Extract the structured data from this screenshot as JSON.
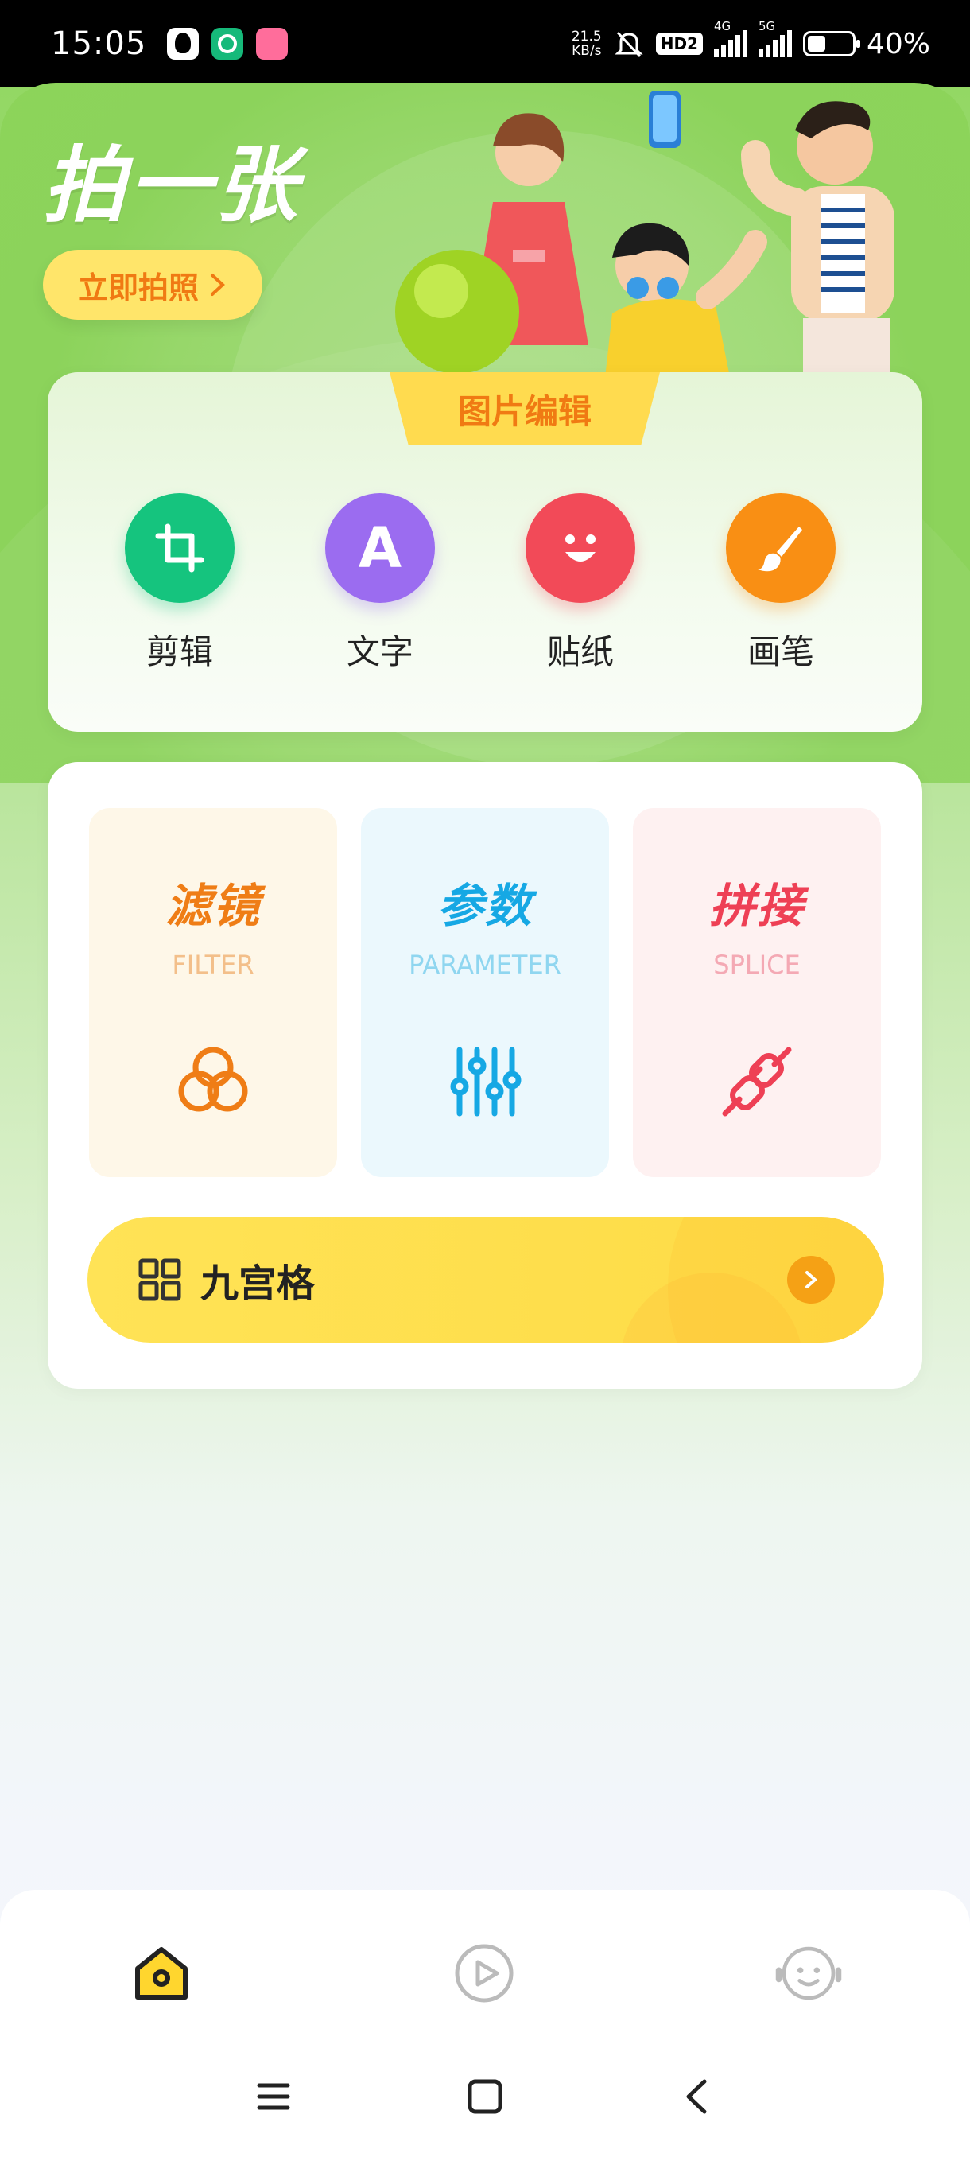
{
  "status_bar": {
    "time": "15:05",
    "net_speed_value": "21.5",
    "net_speed_unit": "KB/s",
    "hd_badge": "HD2",
    "signal1_label": "4G",
    "signal2_label": "5G",
    "battery_text": "40%",
    "battery_level": 0.4,
    "app_icons": [
      "qq-icon",
      "green-app-icon",
      "bilibili-icon"
    ]
  },
  "hero": {
    "title": "拍一张",
    "cta_label": "立即拍照"
  },
  "edit_section": {
    "tab_title": "图片编辑",
    "tools": [
      {
        "label": "剪辑",
        "icon": "crop-icon",
        "color": "#15c47e"
      },
      {
        "label": "文字",
        "icon": "text-a-icon",
        "glyph": "A",
        "color": "#9b6cf0"
      },
      {
        "label": "贴纸",
        "icon": "sticker-smile-icon",
        "color": "#f24a58"
      },
      {
        "label": "画笔",
        "icon": "brush-icon",
        "color": "#f98f14"
      }
    ]
  },
  "features": [
    {
      "title": "滤镜",
      "subtitle": "FILTER",
      "icon": "filter-circles-icon",
      "title_color": "#ef7d16",
      "sub_color": "#f3bf8a",
      "bg": "#fef7e8"
    },
    {
      "title": "参数",
      "subtitle": "PARAMETER",
      "icon": "sliders-icon",
      "title_color": "#16a8e4",
      "sub_color": "#8fd6f0",
      "bg": "#ebf8fd"
    },
    {
      "title": "拼接",
      "subtitle": "SPLICE",
      "icon": "plug-link-icon",
      "title_color": "#ee4055",
      "sub_color": "#f4a9b4",
      "bg": "#fef1f1"
    }
  ],
  "grid_button": {
    "label": "九宫格",
    "icon": "grid-icon"
  },
  "bottom_tabs": [
    {
      "name": "home",
      "icon": "home-icon",
      "active": true
    },
    {
      "name": "video",
      "icon": "play-circle-icon",
      "active": false
    },
    {
      "name": "profile",
      "icon": "smiley-face-icon",
      "active": false
    }
  ],
  "system_nav": [
    "menu-icon",
    "home-square-icon",
    "back-icon"
  ]
}
